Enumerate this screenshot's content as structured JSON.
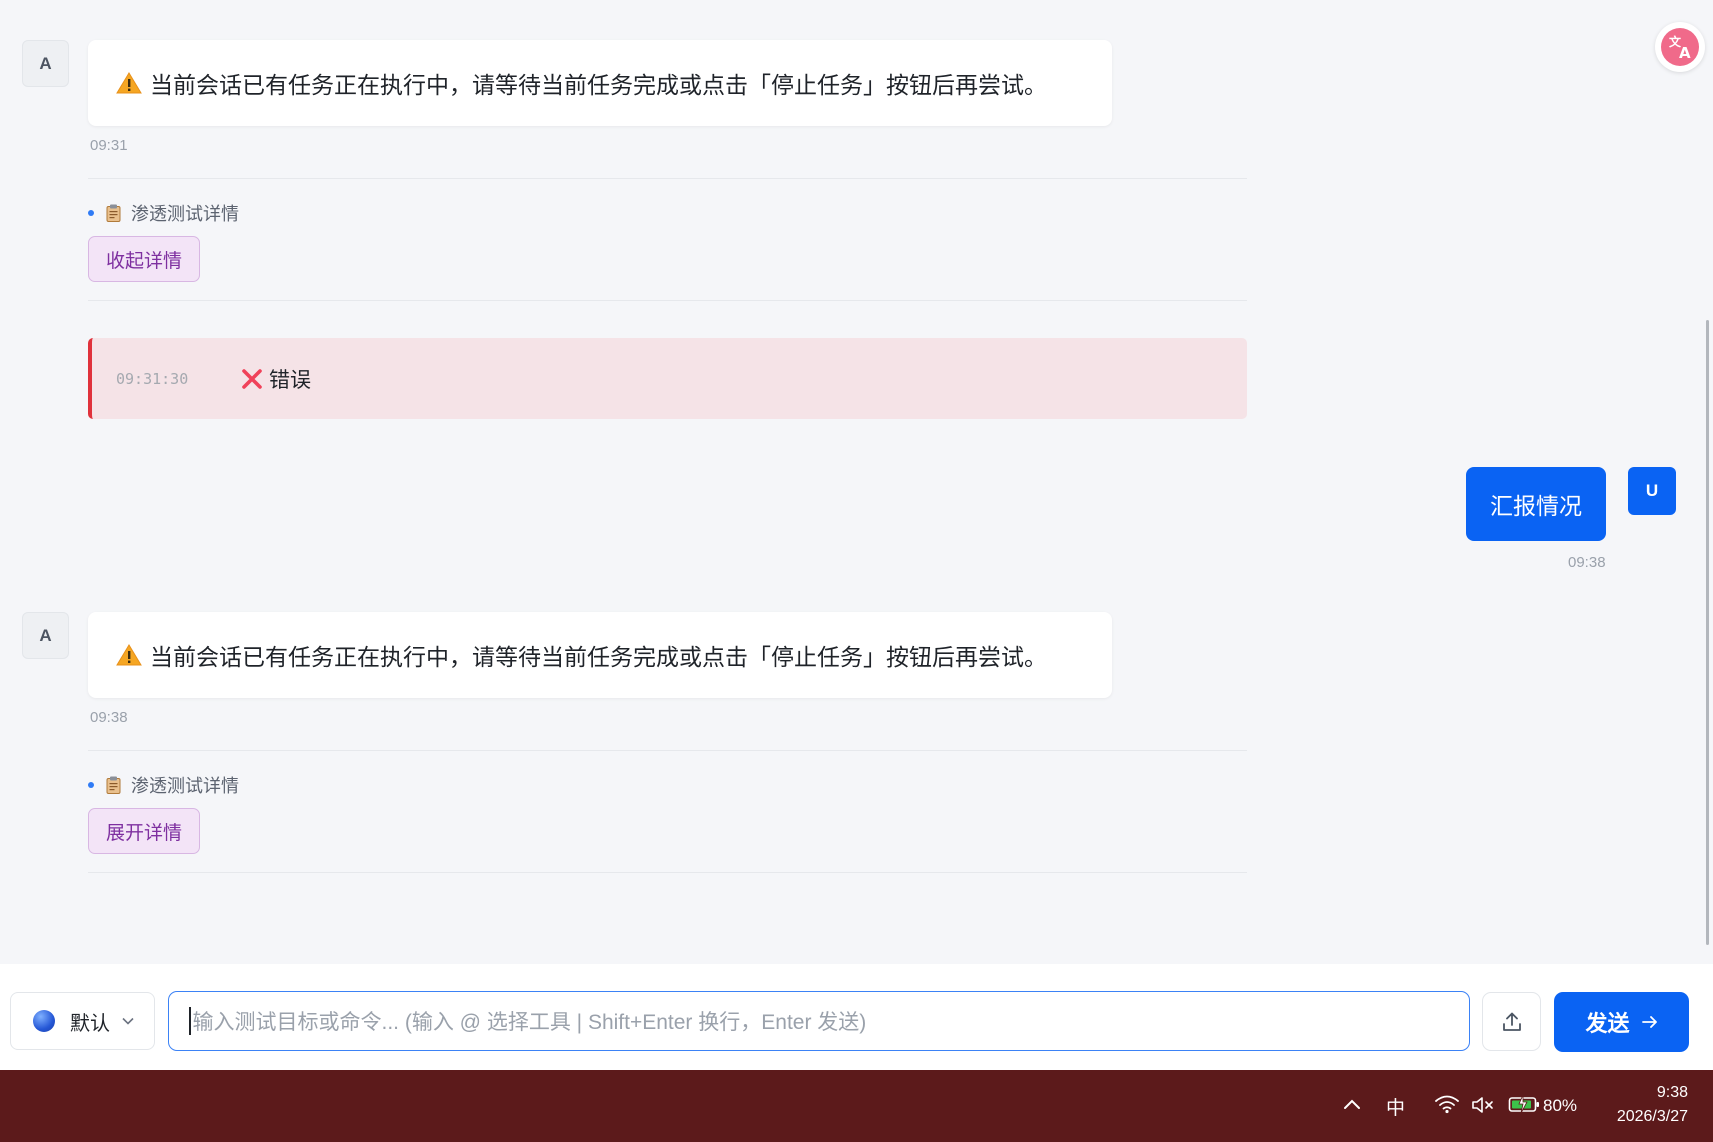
{
  "messages": [
    {
      "role": "assistant",
      "avatar": "A",
      "text": "当前会话已有任务正在执行中，请等待当前任务完成或点击「停止任务」按钮后再尝试。",
      "time": "09:31",
      "detail_title": "渗透测试详情",
      "detail_button": "收起详情"
    },
    {
      "role": "event",
      "time": "09:31:30",
      "label": "错误"
    },
    {
      "role": "user",
      "avatar": "U",
      "text": "汇报情况",
      "time": "09:38"
    },
    {
      "role": "assistant",
      "avatar": "A",
      "text": "当前会话已有任务正在执行中，请等待当前任务完成或点击「停止任务」按钮后再尝试。",
      "time": "09:38",
      "detail_title": "渗透测试详情",
      "detail_button": "展开详情"
    }
  ],
  "composer": {
    "model": "默认",
    "placeholder": "输入测试目标或命令... (输入 @ 选择工具 | Shift+Enter 换行，Enter 发送)",
    "send_label": "发送"
  },
  "taskbar": {
    "ime": "中",
    "battery": "80%",
    "time": "9:38",
    "date": "2026/3/27"
  },
  "icons": [
    "warning-icon",
    "clipboard-icon",
    "error-x-icon",
    "translate-icon",
    "upload-icon",
    "arrow-right-icon",
    "chevron-down-icon",
    "chevron-up-icon",
    "wifi-icon",
    "volume-muted-icon",
    "battery-icon"
  ],
  "colors": {
    "accent": "#0a63f3",
    "error": "#e0323c",
    "detail_button_text": "#7e2fa0",
    "taskbar": "#5c1a1b"
  }
}
